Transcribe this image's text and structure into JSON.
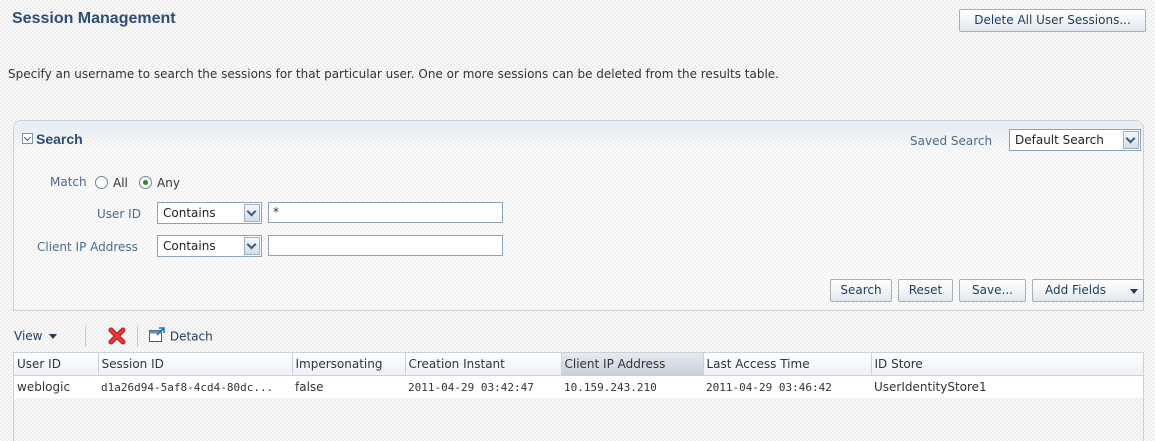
{
  "page": {
    "title": "Session Management",
    "delete_all_label": "Delete All User Sessions...",
    "description": "Specify an username to search the sessions for that particular user. One or more sessions can be deleted from the results table."
  },
  "search": {
    "title": "Search",
    "saved_search_label": "Saved Search",
    "saved_search_value": "Default Search",
    "match_label": "Match",
    "match_options": [
      "All",
      "Any"
    ],
    "match_selected": "Any",
    "user_id_label": "User ID",
    "user_id_operator": "Contains",
    "user_id_value": "*",
    "client_ip_label": "Client IP Address",
    "client_ip_operator": "Contains",
    "client_ip_value": "",
    "buttons": {
      "search": "Search",
      "reset": "Reset",
      "save": "Save...",
      "add_fields": "Add Fields"
    }
  },
  "toolbar": {
    "view_label": "View",
    "detach_label": "Detach",
    "icons": [
      "delete-icon",
      "detach-icon"
    ],
    "delete_color": "#d32020"
  },
  "table": {
    "columns": [
      "User ID",
      "Session ID",
      "Impersonating",
      "Creation Instant",
      "Client IP Address",
      "Last Access Time",
      "ID Store"
    ],
    "sorted_column": "Client IP Address",
    "rows": [
      [
        "weblogic",
        "d1a26d94-5af8-4cd4-80dc...",
        "false",
        "2011-04-29 03:42:47",
        "10.159.243.210",
        "2011-04-29 03:46:42",
        "UserIdentityStore1"
      ]
    ]
  },
  "colors": {
    "title": "#2d4e74",
    "label": "#4d6b8a",
    "radio_selected": "#2c8a2c"
  }
}
